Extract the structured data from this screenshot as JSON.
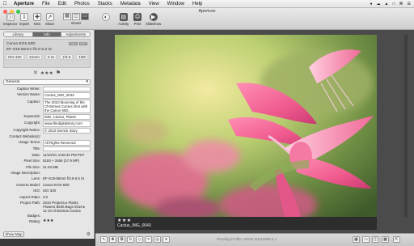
{
  "menubar": {
    "apple": "",
    "items": [
      "Aperture",
      "File",
      "Edit",
      "Photos",
      "Stacks",
      "Metadata",
      "View",
      "Window",
      "Help"
    ],
    "status": [
      "●",
      "☁",
      "▲",
      "□",
      "⌘",
      "☰"
    ]
  },
  "window": {
    "title": "Aperture"
  },
  "toolbar": {
    "inspector": "Inspector",
    "import": "Import",
    "new": "New",
    "share": "Share",
    "viewer": "Viewer",
    "activity": "Activity",
    "print": "Print",
    "slideshow": "Slideshow"
  },
  "inspector": {
    "tabs": [
      "Library",
      "Info",
      "Adjustments"
    ],
    "active_tab": "Info",
    "camera": {
      "name": "Canon EOS 60D",
      "lens": "EF-S18-55mm f/3.5-5.6 IS",
      "badges": [
        "RAW",
        "HDR"
      ],
      "exif": [
        "ISO 320",
        "51mm",
        "0 ev",
        "ƒ/5.6",
        "1/80"
      ]
    },
    "rating": "★★★",
    "preset": "General",
    "fields": [
      {
        "label": "Caption Writer:",
        "value": ""
      },
      {
        "label": "Version Name:",
        "value": "Cactus_IMG_0043"
      },
      {
        "label": "Caption:",
        "value": "The 2010 blooming of the Christmas Cactus shot with the Canon 60D."
      },
      {
        "label": "Keywords:",
        "value": "60D, Cactus, Plants"
      },
      {
        "label": "Copyright:",
        "value": "www.thedigitalstory.com"
      },
      {
        "label": "Copyright Notice:",
        "value": "© 2010 Derrick Story"
      },
      {
        "label": "Contact Website(s):",
        "value": ""
      },
      {
        "label": "Usage Terms:",
        "value": "All Rights Reserved"
      },
      {
        "label": "Title:",
        "value": ""
      },
      {
        "label": "Date:",
        "value": "11/10/10, 8:26:42 PM PST"
      },
      {
        "label": "Pixel Size:",
        "value": "5184 × 3456 (17.9 MP)"
      },
      {
        "label": "File Size:",
        "value": "21.63 MB"
      },
      {
        "label": "Image Description:",
        "value": ""
      },
      {
        "label": "Lens:",
        "value": "EF-S18-55mm f/3.5-5.6 IS"
      },
      {
        "label": "Camera Model:",
        "value": "Canon EOS 60D"
      },
      {
        "label": "ISO:",
        "value": "ISO 320"
      },
      {
        "label": "Aspect Ratio:",
        "value": "3:2"
      },
      {
        "label": "Project Path:",
        "value": "2010 Projects ▸ Plants Flowers Birds Bugs 2010 ▸ 11-10 Christmas Cactus"
      },
      {
        "label": "Badges:",
        "value": ""
      },
      {
        "label": "Rating:",
        "value": "★★★"
      }
    ],
    "show_map": "Show Map"
  },
  "viewer": {
    "stars": "★★★",
    "filename": "Cactus_IMG_0043",
    "status": "Proofing Profile: sRGB IEC61966-2.1"
  },
  "tools": [
    "↖",
    "✥",
    "⧉",
    "↻",
    "◇",
    "✑",
    "◎",
    "▾"
  ]
}
